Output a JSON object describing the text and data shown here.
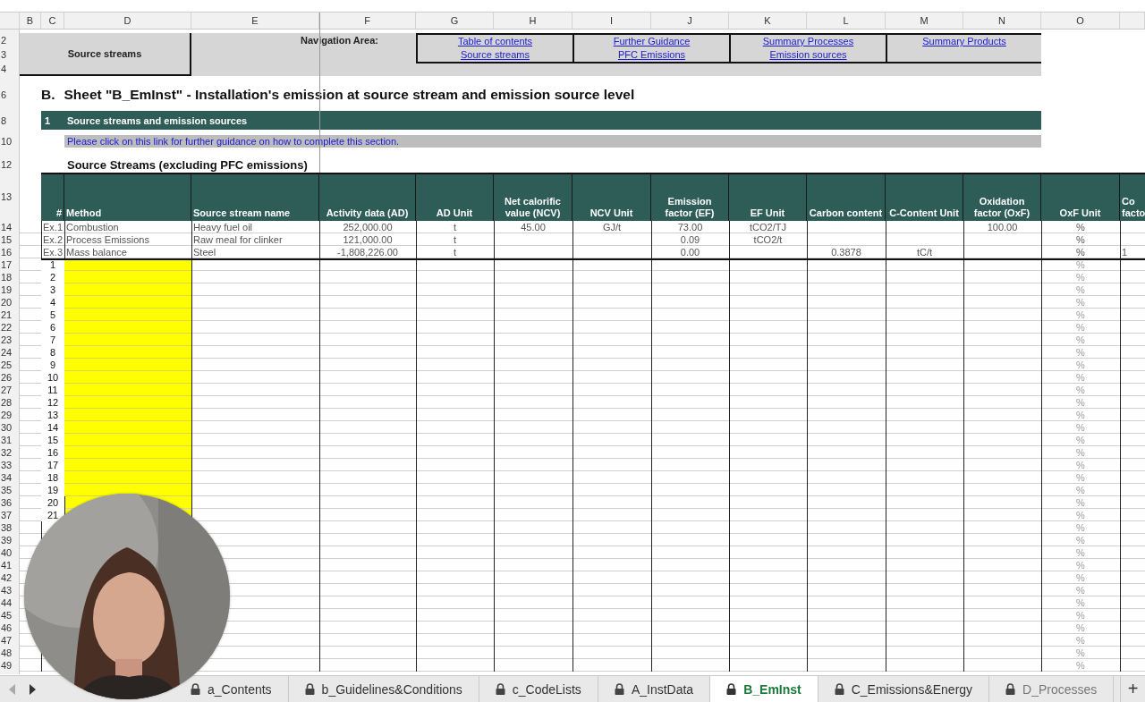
{
  "column_headers": [
    "B",
    "C",
    "D",
    "E",
    "F",
    "G",
    "H",
    "I",
    "J",
    "K",
    "L",
    "M",
    "N",
    "O"
  ],
  "row_numbers": [
    "2",
    "3",
    "4",
    "6",
    "8",
    "10",
    "12",
    "13",
    "14",
    "15",
    "16",
    "17",
    "18",
    "19",
    "20",
    "21",
    "22",
    "23",
    "24",
    "25",
    "26",
    "27",
    "28",
    "29",
    "30",
    "31",
    "32",
    "33",
    "34",
    "35",
    "36",
    "37",
    "38",
    "39",
    "40",
    "41",
    "42",
    "43",
    "44",
    "45",
    "46",
    "47",
    "48",
    "49"
  ],
  "navigation": {
    "sheet_label": "Source streams",
    "label": "Navigation Area:",
    "links": [
      {
        "text": "Table of contents"
      },
      {
        "text": "Further Guidance"
      },
      {
        "text": "Summary  Processes"
      },
      {
        "text": "Summary  Products"
      },
      {
        "text": "Source streams"
      },
      {
        "text": "PFC Emissions"
      },
      {
        "text": "Emission sources"
      }
    ]
  },
  "sheet_title": {
    "marker": "B.",
    "text": "Sheet \"B_EmInst\" - Installation's emission at source stream and emission source level"
  },
  "section": {
    "number": "1",
    "title": "Source streams and emission sources"
  },
  "guidance_link": "Please click on this link for further guidance on how to complete this section.",
  "table": {
    "title": "Source Streams (excluding PFC emissions)",
    "columns": [
      "#",
      "Method",
      "Source stream name",
      "Activity data (AD)",
      "AD Unit",
      "Net calorific value (NCV)",
      "NCV Unit",
      "Emission factor (EF)",
      "EF Unit",
      "Carbon content",
      "C-Content Unit",
      "Oxidation factor (OxF)",
      "OxF Unit",
      "Co facto"
    ],
    "examples": [
      {
        "index": "Ex.1",
        "method": "Combustion",
        "name": "Heavy fuel oil",
        "activity": "252,000.00",
        "ad_unit": "t",
        "ncv": "45.00",
        "ncv_unit": "GJ/t",
        "ef": "73.00",
        "ef_unit": "tCO2/TJ",
        "oxf": "100.00",
        "oxf_unit": "%"
      },
      {
        "index": "Ex.2",
        "method": "Process Emissions",
        "name": "Raw meal for clinker",
        "activity": "121,000.00",
        "ad_unit": "t",
        "ef": "0.09",
        "ef_unit": "tCO2/t",
        "oxf_unit": "%"
      },
      {
        "index": "Ex.3",
        "method": "Mass balance",
        "name": "Steel",
        "activity": "-1,808,226.00",
        "ad_unit": "t",
        "ef": "0.00",
        "carbon": "0.3878",
        "c_unit": "tC/t",
        "oxf_unit": "%",
        "column_p": "1"
      }
    ],
    "entries": [
      {
        "number": "1",
        "oxf_unit": "%"
      },
      {
        "number": "2",
        "oxf_unit": "%"
      },
      {
        "number": "3",
        "oxf_unit": "%"
      },
      {
        "number": "4",
        "oxf_unit": "%"
      },
      {
        "number": "5",
        "oxf_unit": "%"
      },
      {
        "number": "6",
        "oxf_unit": "%"
      },
      {
        "number": "7",
        "oxf_unit": "%"
      },
      {
        "number": "8",
        "oxf_unit": "%"
      },
      {
        "number": "9",
        "oxf_unit": "%"
      },
      {
        "number": "10",
        "oxf_unit": "%"
      },
      {
        "number": "11",
        "oxf_unit": "%"
      },
      {
        "number": "12",
        "oxf_unit": "%"
      },
      {
        "number": "13",
        "oxf_unit": "%"
      },
      {
        "number": "14",
        "oxf_unit": "%"
      },
      {
        "number": "15",
        "oxf_unit": "%"
      },
      {
        "number": "16",
        "oxf_unit": "%"
      },
      {
        "number": "17",
        "oxf_unit": "%"
      },
      {
        "number": "18",
        "oxf_unit": "%"
      },
      {
        "number": "19",
        "oxf_unit": "%"
      },
      {
        "number": "20",
        "oxf_unit": "%"
      },
      {
        "number": "21",
        "oxf_unit": "%"
      },
      {
        "oxf_unit": "%"
      },
      {
        "oxf_unit": "%"
      },
      {
        "oxf_unit": "%"
      },
      {
        "oxf_unit": "%"
      },
      {
        "oxf_unit": "%"
      },
      {
        "oxf_unit": "%"
      },
      {
        "oxf_unit": "%"
      },
      {
        "oxf_unit": "%"
      },
      {
        "oxf_unit": "%"
      },
      {
        "oxf_unit": "%"
      },
      {
        "oxf_unit": "%"
      },
      {
        "oxf_unit": "%"
      }
    ]
  },
  "tabs": [
    {
      "label": "a_Contents",
      "selected": false
    },
    {
      "label": "b_Guidelines&Conditions",
      "selected": false
    },
    {
      "label": "c_CodeLists",
      "selected": false
    },
    {
      "label": "A_InstData",
      "selected": false
    },
    {
      "label": "B_EmInst",
      "selected": true
    },
    {
      "label": "C_Emissions&Energy",
      "selected": false
    },
    {
      "label": "D_Processes",
      "selected": false
    }
  ],
  "tab_add": "+"
}
